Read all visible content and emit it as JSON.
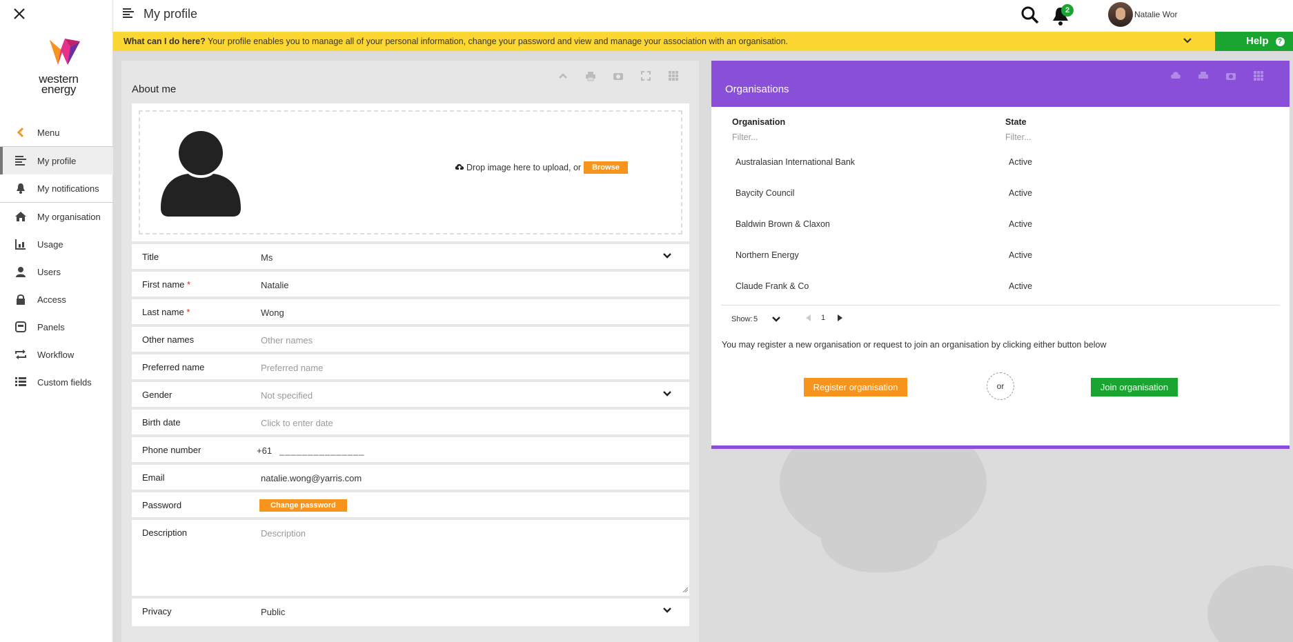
{
  "header": {
    "page_title": "My profile",
    "notification_count": "2",
    "user_name": "Natalie Wor"
  },
  "logo": {
    "line1": "western",
    "line2": "energy"
  },
  "sidebar": {
    "items": [
      {
        "label": "Menu",
        "icon": "chevron-left-icon"
      },
      {
        "label": "My profile",
        "icon": "profile-lines-icon"
      },
      {
        "label": "My notifications",
        "icon": "bell-icon"
      },
      {
        "label": "My organisation",
        "icon": "home-icon"
      },
      {
        "label": "Usage",
        "icon": "usage-chart-icon"
      },
      {
        "label": "Users",
        "icon": "user-icon"
      },
      {
        "label": "Access",
        "icon": "lock-icon"
      },
      {
        "label": "Panels",
        "icon": "panels-icon"
      },
      {
        "label": "Workflow",
        "icon": "workflow-arrows-icon"
      },
      {
        "label": "Custom fields",
        "icon": "list-icon"
      }
    ]
  },
  "banner": {
    "question": "What can I do here?",
    "text": " Your profile enables you to manage all of your personal information, change your password and view and manage your association with an organisation.",
    "help_label": "Help"
  },
  "about": {
    "title": "About me",
    "drop_text": "Drop image here to upload, or",
    "browse_label": "Browse",
    "fields": [
      {
        "label": "Title",
        "value": "Ms",
        "required": false
      },
      {
        "label": "First name",
        "value": "Natalie",
        "required": true
      },
      {
        "label": "Last name",
        "value": "Wong",
        "required": true
      },
      {
        "label": "Other names",
        "placeholder": "Other names",
        "required": false
      },
      {
        "label": "Preferred name",
        "placeholder": "Preferred name",
        "required": false
      },
      {
        "label": "Gender",
        "placeholder": "Not specified",
        "required": false
      },
      {
        "label": "Birth date",
        "placeholder": "Click to enter date",
        "required": false
      },
      {
        "label": "Phone number",
        "prefix": "+61",
        "mask": "_______________",
        "required": false
      },
      {
        "label": "Email",
        "value": "natalie.wong@yarris.com",
        "required": false
      },
      {
        "label": "Password",
        "button": "Change password",
        "required": false
      },
      {
        "label": "Description",
        "placeholder": "Description",
        "required": false
      },
      {
        "label": "Privacy",
        "value": "Public",
        "required": false
      }
    ],
    "required_mark": "*"
  },
  "organisations": {
    "title": "Organisations",
    "columns": [
      "Organisation",
      "State"
    ],
    "filter_placeholder": "Filter...",
    "rows": [
      {
        "name": "Australasian International Bank",
        "state": "Active"
      },
      {
        "name": "Baycity Council",
        "state": "Active"
      },
      {
        "name": "Baldwin Brown & Claxon",
        "state": "Active"
      },
      {
        "name": "Northern Energy",
        "state": "Active"
      },
      {
        "name": "Claude Frank & Co",
        "state": "Active"
      }
    ],
    "show_label": "Show:",
    "show_value": "5",
    "page": "1",
    "note": "You may register a new organisation or request to join an organisation by clicking either button below",
    "register_label": "Register organisation",
    "or_label": "or",
    "join_label": "Join organisation"
  },
  "colors": {
    "accent_orange": "#f7941d",
    "accent_green": "#1aa531",
    "banner_yellow": "#fcd734",
    "panel_purple": "#8a4fd8"
  }
}
